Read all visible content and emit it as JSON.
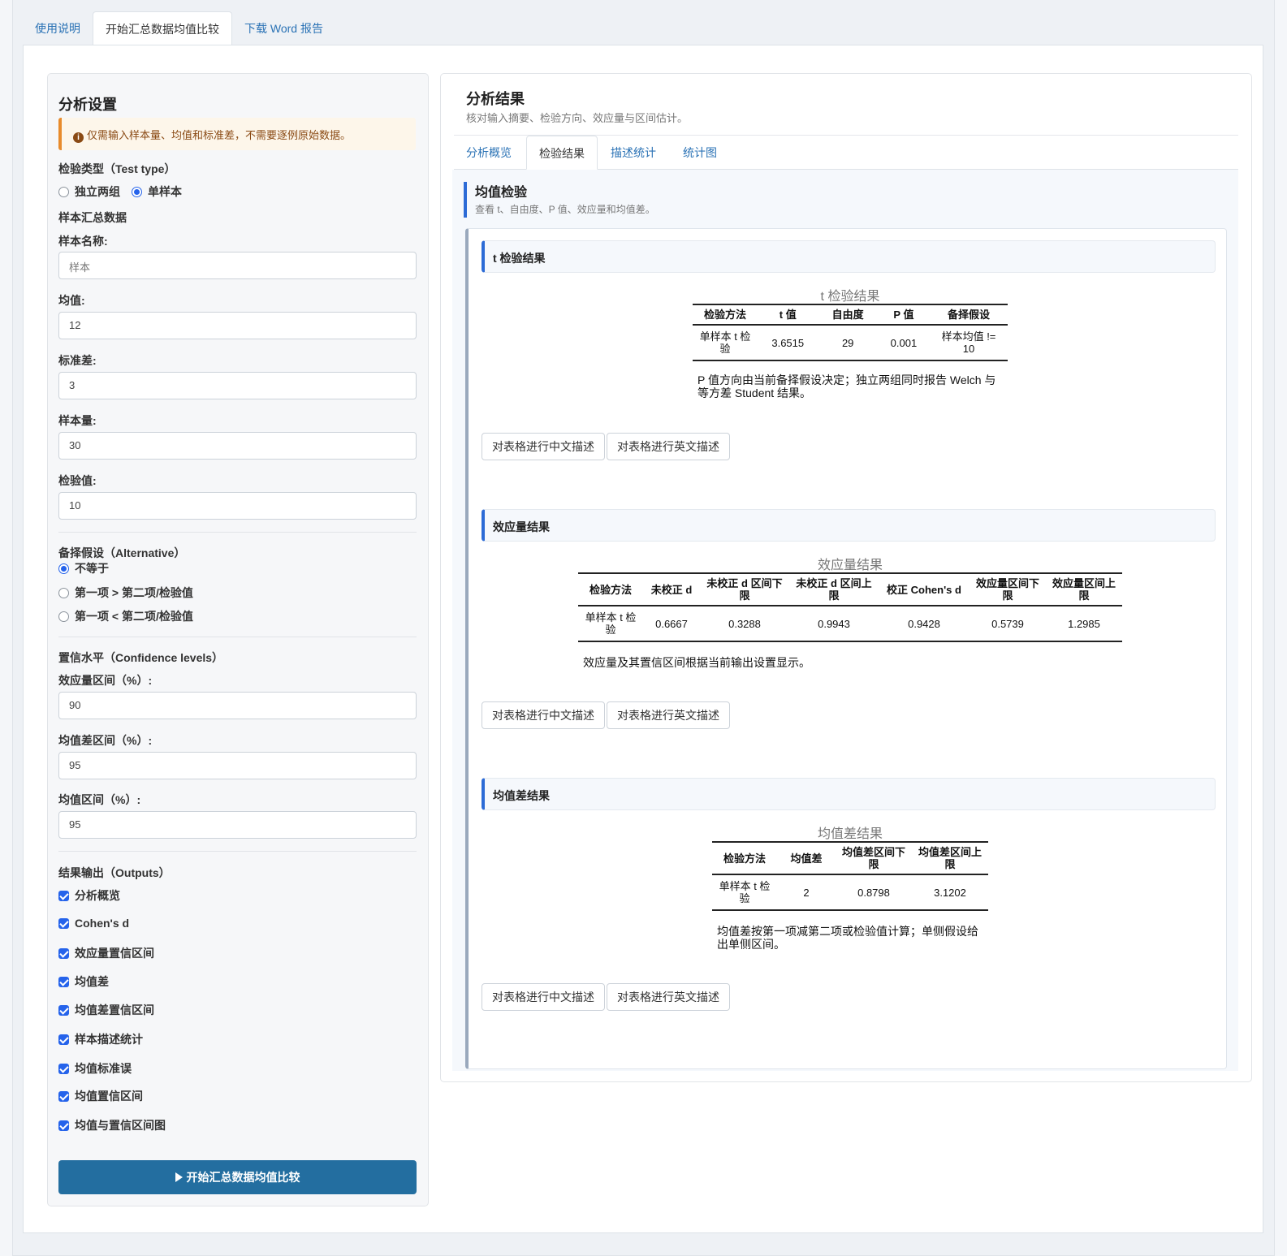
{
  "top_tabs": [
    "使用说明",
    "开始汇总数据均值比较",
    "下载 Word 报告"
  ],
  "left": {
    "title": "分析设置",
    "alert": "仅需输入样本量、均值和标准差，不需要逐例原始数据。",
    "test_type_label": "检验类型（Test type）",
    "test_type_options": [
      "独立两组",
      "单样本"
    ],
    "summary_label": "样本汇总数据",
    "fields": [
      {
        "label": "样本名称:",
        "placeholder": "样本",
        "value": ""
      },
      {
        "label": "均值:",
        "value": "12"
      },
      {
        "label": "标准差:",
        "value": "3"
      },
      {
        "label": "样本量:",
        "value": "30"
      },
      {
        "label": "检验值:",
        "value": "10"
      }
    ],
    "alternative_label": "备择假设（Alternative）",
    "alternative_options": [
      "不等于",
      "第一项 > 第二项/检验值",
      "第一项 < 第二项/检验值"
    ],
    "confidence_label": "置信水平（Confidence levels）",
    "conf_fields": [
      {
        "label": "效应量区间（%）:",
        "value": "90"
      },
      {
        "label": "均值差区间（%）:",
        "value": "95"
      },
      {
        "label": "均值区间（%）:",
        "value": "95"
      }
    ],
    "outputs_label": "结果输出（Outputs）",
    "outputs": [
      "分析概览",
      "Cohen's d",
      "效应量置信区间",
      "均值差",
      "均值差置信区间",
      "样本描述统计",
      "均值标准误",
      "均值置信区间",
      "均值与置信区间图"
    ],
    "run_button": "开始汇总数据均值比较"
  },
  "right": {
    "title": "分析结果",
    "subtitle": "核对输入摘要、检验方向、效应量与区间估计。",
    "tabs": [
      "分析概览",
      "检验结果",
      "描述统计",
      "统计图"
    ],
    "section_title": "均值检验",
    "section_sub": "查看 t、自由度、P 值、效应量和均值差。",
    "btn_cn": "对表格进行中文描述",
    "btn_en": "对表格进行英文描述",
    "t_test": {
      "head": "t 检验结果",
      "title": "t 检验结果",
      "columns": [
        "检验方法",
        "t 值",
        "自由度",
        "P 值",
        "备择假设"
      ],
      "row": [
        "单样本 t 检验",
        "3.6515",
        "29",
        "0.001",
        "样本均值 != 10"
      ],
      "note": "P 值方向由当前备择假设决定；独立两组同时报告 Welch 与等方差 Student 结果。"
    },
    "effect": {
      "head": "效应量结果",
      "title": "效应量结果",
      "columns": [
        "检验方法",
        "未校正 d",
        "未校正 d 区间下限",
        "未校正 d 区间上限",
        "校正 Cohen's d",
        "效应量区间下限",
        "效应量区间上限"
      ],
      "row": [
        "单样本 t 检验",
        "0.6667",
        "0.3288",
        "0.9943",
        "0.9428",
        "0.5739",
        "1.2985"
      ],
      "note": "效应量及其置信区间根据当前输出设置显示。"
    },
    "meandiff": {
      "head": "均值差结果",
      "title": "均值差结果",
      "columns": [
        "检验方法",
        "均值差",
        "均值差区间下限",
        "均值差区间上限"
      ],
      "row": [
        "单样本 t 检验",
        "2",
        "0.8798",
        "3.1202"
      ],
      "note": "均值差按第一项减第二项或检验值计算；单侧假设给出单侧区间。"
    }
  }
}
